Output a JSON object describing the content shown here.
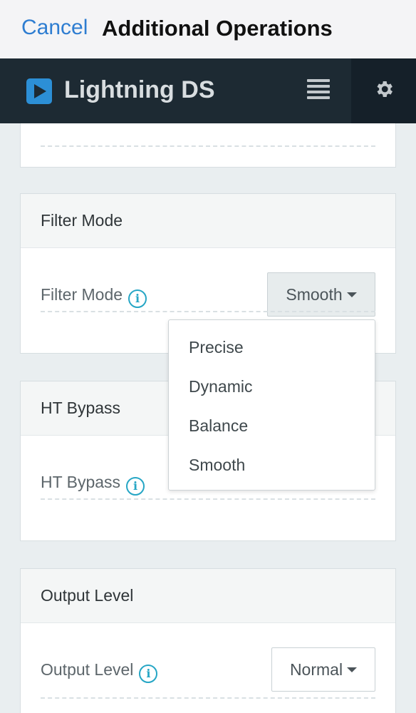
{
  "modal": {
    "cancel_label": "Cancel",
    "title": "Additional Operations"
  },
  "app": {
    "title": "Lightning DS",
    "menu_icon": "list-icon",
    "settings_icon": "gear-icon",
    "logo_icon": "play-icon"
  },
  "colors": {
    "accent": "#2e7dd1",
    "header_bg": "#1d2a33",
    "logo": "#2c8fd6",
    "info": "#26a6c5"
  },
  "filter_mode": {
    "section_title": "Filter Mode",
    "label": "Filter Mode",
    "selected": "Smooth",
    "options": [
      "Precise",
      "Dynamic",
      "Balance",
      "Smooth"
    ]
  },
  "ht_bypass": {
    "section_title": "HT Bypass",
    "label": "HT Bypass"
  },
  "output_level": {
    "section_title": "Output Level",
    "label": "Output Level",
    "selected": "Normal"
  }
}
